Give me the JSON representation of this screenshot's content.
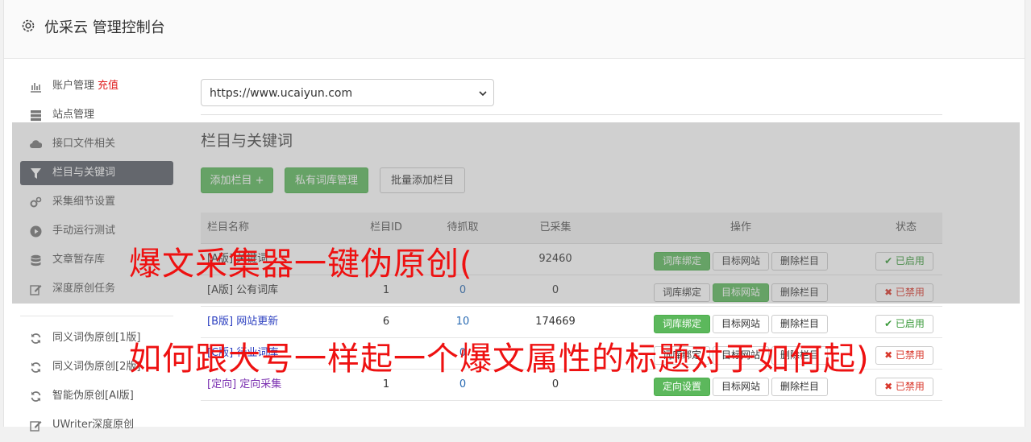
{
  "header": {
    "title": "优采云 管理控制台",
    "icon": "gear-icon"
  },
  "sidebar": {
    "items": [
      {
        "label": "账户管理",
        "extra": "充值",
        "icon": "bar-chart-icon"
      },
      {
        "label": "站点管理",
        "icon": "server-icon"
      },
      {
        "label": "接口文件相关",
        "icon": "cloud-upload-icon"
      },
      {
        "label": "栏目与关键词",
        "icon": "filter-icon",
        "active": true
      },
      {
        "label": "采集细节设置",
        "icon": "cogs-icon"
      },
      {
        "label": "手动运行测试",
        "icon": "play-circle-icon"
      },
      {
        "label": "文章暂存库",
        "icon": "database-icon"
      },
      {
        "label": "深度原创任务",
        "icon": "edit-icon"
      }
    ],
    "items2": [
      {
        "label": "同义词伪原创[1版]",
        "icon": "refresh-icon"
      },
      {
        "label": "同义词伪原创[2版]",
        "icon": "refresh-icon"
      },
      {
        "label": "智能伪原创[AI版]",
        "icon": "refresh-icon"
      },
      {
        "label": "UWriter深度原创",
        "icon": "edit-icon"
      }
    ]
  },
  "site_select": {
    "value": "https://www.ucaiyun.com"
  },
  "section": {
    "title": "栏目与关键词",
    "add_button": "添加栏目 +",
    "private_button": "私有词库管理",
    "batch_button": "批量添加栏目"
  },
  "table": {
    "headers": {
      "name": "栏目名称",
      "id": "栏目ID",
      "wait": "待抓取",
      "done": "已采集",
      "op": "操作",
      "status": "状态"
    },
    "rows": [
      {
        "name": "[A版] 关键词",
        "id": "",
        "wait": "",
        "done": "92460",
        "op1": "词库绑定",
        "op2": "目标网站",
        "op3": "删除栏目",
        "status": "✔ 已启用"
      },
      {
        "name": "[A版] 公有词库",
        "id": "1",
        "wait": "0",
        "done": "0",
        "op1": "词库绑定",
        "op2": "目标网站",
        "op3": "删除栏目",
        "status": "✖ 已禁用"
      },
      {
        "name": "[B版] 网站更新",
        "id": "6",
        "wait": "10",
        "done": "174669",
        "op1": "词库绑定",
        "op2": "目标网站",
        "op3": "删除栏目",
        "status": "✔ 已启用"
      },
      {
        "name": "[C版] 行业词库",
        "id": "",
        "wait": "0",
        "done": "",
        "op1": "词库绑定",
        "op2": "目标网站",
        "op3": "删除栏目",
        "status": "✖ 已禁用"
      },
      {
        "name": "[定向] 定向采集",
        "id": "1",
        "wait": "0",
        "done": "0",
        "op1": "定向设置",
        "op2": "目标网站",
        "op3": "删除栏目",
        "status": "✖ 已禁用"
      }
    ]
  },
  "watermark": {
    "line1": "爆文采集器一键伪原创(",
    "line2": "如何跟大号一样起一个爆文属性的标题对于如何起)"
  },
  "colors": {
    "green": "#5cb85c",
    "red": "#ee1111",
    "active_bg": "#5a5f68"
  }
}
